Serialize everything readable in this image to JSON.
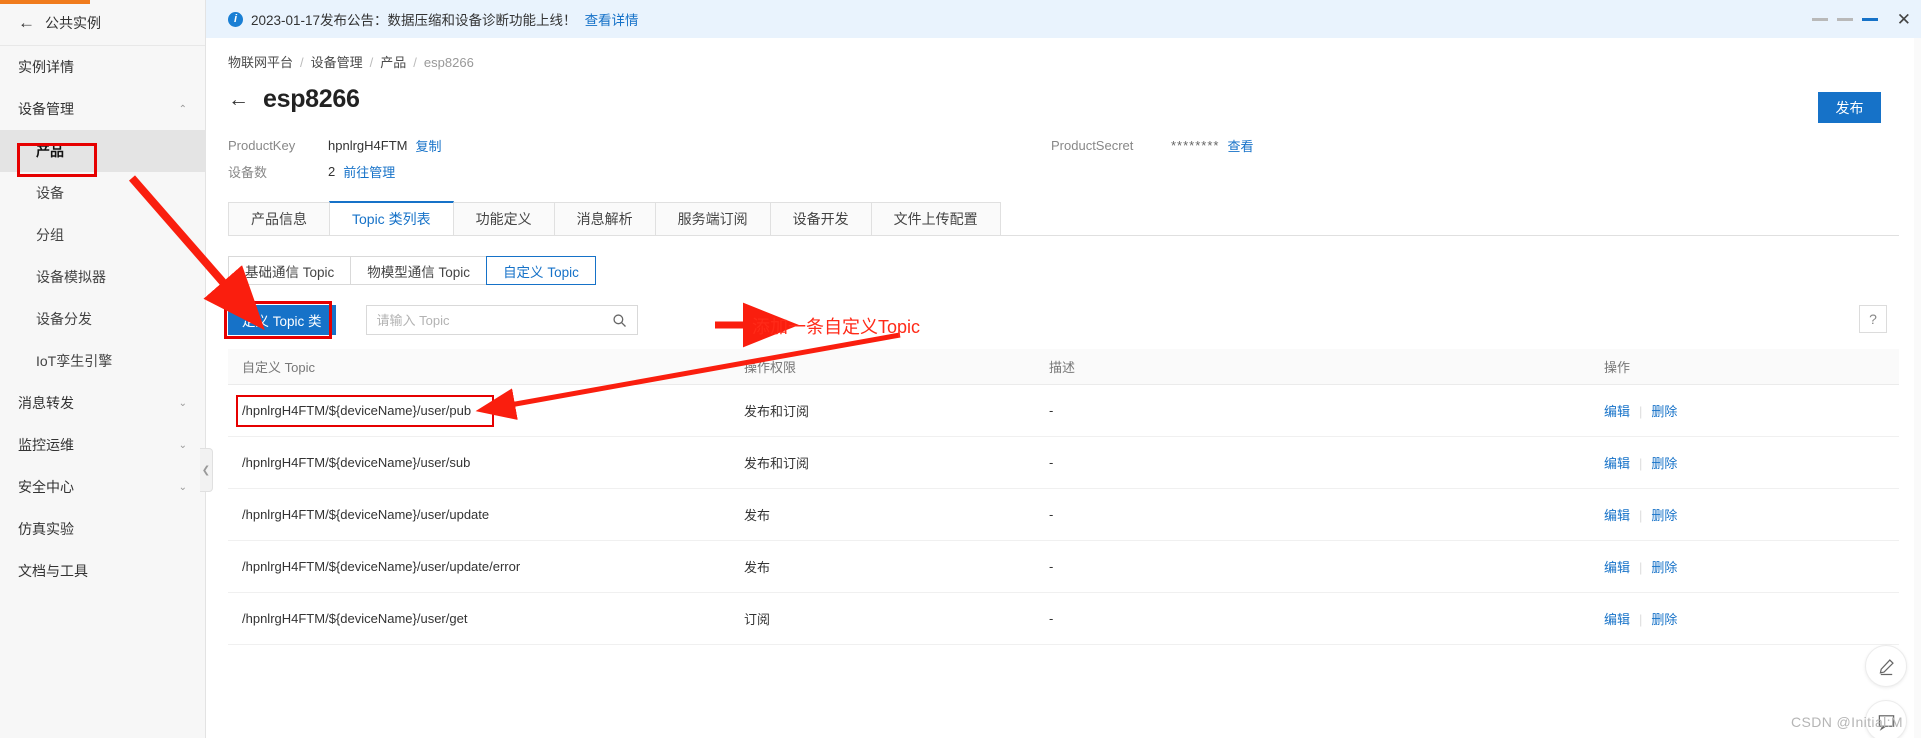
{
  "sidebar": {
    "instance_back_label": "公共实例",
    "items": [
      {
        "label": "实例详情",
        "type": "item"
      },
      {
        "label": "设备管理",
        "type": "group",
        "caret": "up"
      },
      {
        "label": "产品",
        "type": "sub",
        "active": true
      },
      {
        "label": "设备",
        "type": "sub"
      },
      {
        "label": "分组",
        "type": "sub"
      },
      {
        "label": "设备模拟器",
        "type": "sub"
      },
      {
        "label": "设备分发",
        "type": "sub"
      },
      {
        "label": "IoT孪生引擎",
        "type": "sub"
      },
      {
        "label": "消息转发",
        "type": "group",
        "caret": "down"
      },
      {
        "label": "监控运维",
        "type": "group",
        "caret": "down"
      },
      {
        "label": "安全中心",
        "type": "group",
        "caret": "down"
      },
      {
        "label": "仿真实验",
        "type": "item"
      },
      {
        "label": "文档与工具",
        "type": "item"
      }
    ]
  },
  "banner": {
    "text": "2023-01-17发布公告：数据压缩和设备诊断功能上线！",
    "link": "查看详情",
    "info_icon": "info-icon",
    "close_icon": "close-icon"
  },
  "breadcrumb": [
    "物联网平台",
    "设备管理",
    "产品",
    "esp8266"
  ],
  "header": {
    "title": "esp8266",
    "back_icon": "back-arrow-icon",
    "publish_label": "发布"
  },
  "meta": {
    "product_key_label": "ProductKey",
    "product_key_value": "hpnlrgH4FTM",
    "copy_label": "复制",
    "device_count_label": "设备数",
    "device_count_value": "2",
    "manage_link": "前往管理",
    "product_secret_label": "ProductSecret",
    "product_secret_value": "********",
    "view_label": "查看"
  },
  "tabs": [
    {
      "label": "产品信息",
      "active": false
    },
    {
      "label": "Topic 类列表",
      "active": true
    },
    {
      "label": "功能定义",
      "active": false
    },
    {
      "label": "消息解析",
      "active": false
    },
    {
      "label": "服务端订阅",
      "active": false
    },
    {
      "label": "设备开发",
      "active": false
    },
    {
      "label": "文件上传配置",
      "active": false
    }
  ],
  "subtabs": [
    {
      "label": "基础通信 Topic",
      "active": false
    },
    {
      "label": "物模型通信 Topic",
      "active": false
    },
    {
      "label": "自定义 Topic",
      "active": true
    }
  ],
  "toolbar": {
    "define_button": "定义 Topic 类",
    "search_placeholder": "请输入 Topic",
    "search_value": "",
    "search_icon": "search-icon",
    "help_icon": "question-mark-icon"
  },
  "table": {
    "columns": [
      "自定义 Topic",
      "操作权限",
      "描述",
      "操作"
    ],
    "rows": [
      {
        "topic": "/hpnlrgH4FTM/${deviceName}/user/pub",
        "perm": "发布和订阅",
        "desc": "-",
        "edit": "编辑",
        "delete": "删除"
      },
      {
        "topic": "/hpnlrgH4FTM/${deviceName}/user/sub",
        "perm": "发布和订阅",
        "desc": "-",
        "edit": "编辑",
        "delete": "删除"
      },
      {
        "topic": "/hpnlrgH4FTM/${deviceName}/user/update",
        "perm": "发布",
        "desc": "-",
        "edit": "编辑",
        "delete": "删除"
      },
      {
        "topic": "/hpnlrgH4FTM/${deviceName}/user/update/error",
        "perm": "发布",
        "desc": "-",
        "edit": "编辑",
        "delete": "删除"
      },
      {
        "topic": "/hpnlrgH4FTM/${deviceName}/user/get",
        "perm": "订阅",
        "desc": "-",
        "edit": "编辑",
        "delete": "删除"
      }
    ]
  },
  "annotations": {
    "note_text": "添加一条自定义Topic",
    "highlight_color": "#e60000",
    "note_color": "#ff2a18"
  },
  "float_buttons": {
    "edit_icon": "pencil-icon",
    "feedback_icon": "feedback-icon"
  },
  "watermark": "CSDN @Initial:M",
  "colors": {
    "accent": "#1672c8",
    "banner_bg": "#e9f3fd",
    "sidebar_bg": "#f7f7f7"
  }
}
